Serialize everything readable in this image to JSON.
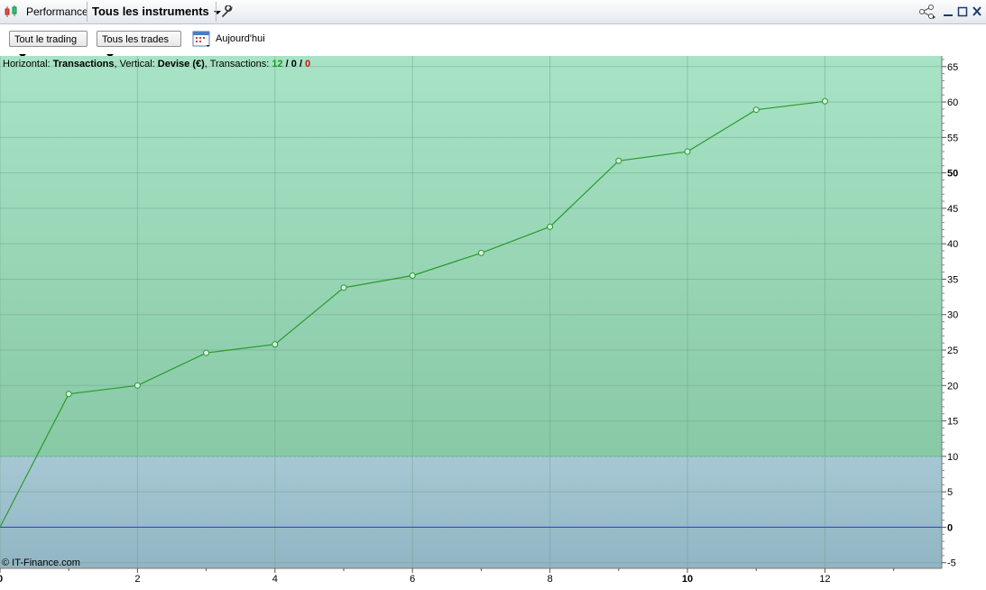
{
  "toolbar": {
    "tab_label": "Performance",
    "instrument_label": "Tous les instruments"
  },
  "filters": {
    "trading_label": "Tout le trading",
    "trades_label": "Tous les trades",
    "date_label": "Aujourd'hui"
  },
  "header": {
    "horizontal_prefix": "Horizontal: ",
    "horizontal_value": "Transactions",
    "vertical_prefix": ", Vertical: ",
    "vertical_value": "Devise (€)",
    "transactions_prefix": ", Transactions: ",
    "count_total": "12",
    "sep1": " / ",
    "count_neutral": "0",
    "sep2": " / ",
    "count_loss": "0"
  },
  "copyright": "© IT-Finance.com",
  "colors": {
    "line": "#2a9a2a",
    "profit_area": "#8fd1b0",
    "loss_area": "#9fbfce",
    "zero_line": "#2e3ad0",
    "count_green": "#1a9a1a",
    "count_red": "#cc1111"
  },
  "chart_data": {
    "type": "line",
    "x": [
      0,
      1,
      2,
      3,
      4,
      5,
      6,
      7,
      8,
      9,
      10,
      11,
      12
    ],
    "values": [
      0,
      18.8,
      20,
      24.6,
      25.8,
      33.8,
      35.5,
      38.7,
      42.4,
      51.7,
      53,
      58.9,
      60.1
    ],
    "xlim": [
      0,
      13.7
    ],
    "ylim": [
      -5.8,
      66.5
    ],
    "x_ticks": [
      "0",
      "2",
      "4",
      "6",
      "8",
      "10",
      "12"
    ],
    "x_tick_values": [
      0,
      2,
      4,
      6,
      8,
      10,
      12
    ],
    "x_bold_ticks": [
      0,
      10
    ],
    "y_ticks": [
      "-5",
      "0",
      "5",
      "10",
      "15",
      "20",
      "25",
      "30",
      "35",
      "40",
      "45",
      "50",
      "55",
      "60",
      "65"
    ],
    "y_tick_values": [
      -5,
      0,
      5,
      10,
      15,
      20,
      25,
      30,
      35,
      40,
      45,
      50,
      55,
      60,
      65
    ],
    "y_bold_ticks": [
      0,
      50
    ],
    "threshold": 10,
    "grid": true
  }
}
